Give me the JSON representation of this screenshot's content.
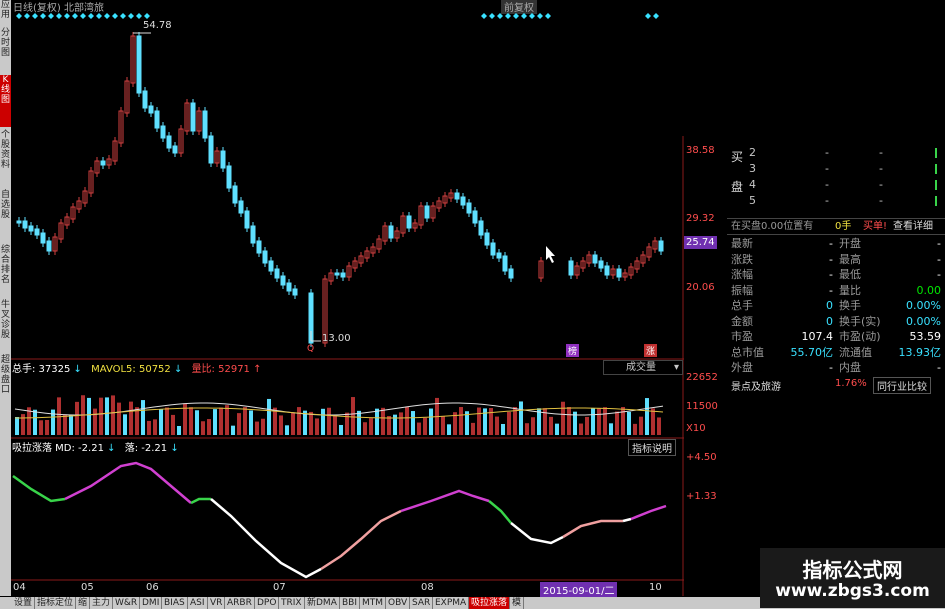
{
  "topbar": {
    "title": "日线(复权)  北部湾旅",
    "right_btn": "前复权"
  },
  "left_tabs": [
    {
      "label": "应用",
      "active": false
    },
    {
      "label": "分时图",
      "active": false
    },
    {
      "label": "K线图",
      "active": true
    },
    {
      "label": "个股资料",
      "active": false
    },
    {
      "label": "自选股",
      "active": false
    },
    {
      "label": "综合排名",
      "active": false
    },
    {
      "label": "牛叉诊股",
      "active": false
    },
    {
      "label": "超级盘口",
      "active": false
    }
  ],
  "main": {
    "high_label": "54.78",
    "low_label": "13.00",
    "q_label": "Q",
    "price_ticks": [
      "38.58",
      "29.32",
      "25.74",
      "20.06"
    ],
    "event_labels": [
      "榜",
      "涨"
    ]
  },
  "volume": {
    "total_label": "总手: 37325",
    "mavol_label": "MAVOL5: 50752",
    "ratio_label": "量比: 52971",
    "dropdown": "成交量",
    "ticks": [
      "22652",
      "11500",
      "X10"
    ]
  },
  "indicator": {
    "title": "吸拉涨落 MD: -2.21",
    "sub": "落: -2.21",
    "help_btn": "指标说明",
    "ticks": [
      "+4.50",
      "+1.33"
    ]
  },
  "xaxis": {
    "labels": [
      "04",
      "05",
      "06",
      "07",
      "08",
      "09",
      "10"
    ],
    "cursor_date": "2015-09-01/二"
  },
  "right_panel": {
    "buy_label": "买",
    "sell_label": "盘",
    "order_levels": [
      "2",
      "3",
      "4",
      "5"
    ],
    "order_dash": "-",
    "orderbar_label": "在买盘0.00位置有",
    "orderbar_hand": "0手",
    "orderbar_buy": "买单!",
    "orderbar_detail": "查看详细",
    "rows": [
      {
        "l": "最新",
        "lv": "-",
        "r": "开盘",
        "rv": "-"
      },
      {
        "l": "涨跌",
        "lv": "-",
        "r": "最高",
        "rv": "-"
      },
      {
        "l": "涨幅",
        "lv": "-",
        "r": "最低",
        "rv": "-"
      },
      {
        "l": "振幅",
        "lv": "-",
        "r": "量比",
        "rv": "0.00"
      },
      {
        "l": "总手",
        "lv": "0",
        "r": "换手",
        "rv": "0.00%"
      },
      {
        "l": "金额",
        "lv": "0",
        "r": "换手(实)",
        "rv": "0.00%"
      },
      {
        "l": "市盈",
        "lv": "107.4",
        "r": "市盈(动)",
        "rv": "53.59"
      },
      {
        "l": "总市值",
        "lv": "55.70亿",
        "r": "流通值",
        "rv": "13.93亿"
      },
      {
        "l": "外盘",
        "lv": "-",
        "r": "内盘",
        "rv": "-"
      }
    ],
    "sector": "景点及旅游",
    "sector_pct": "1.76%",
    "compare_btn": "同行业比较"
  },
  "bottom_tabs": [
    "设置",
    "指标定位",
    "缩",
    "主力",
    "W&R",
    "DMI",
    "BIAS",
    "ASI",
    "VR",
    "ARBR",
    "DPO",
    "TRIX",
    "新DMA",
    "BBI",
    "MTM",
    "OBV",
    "SAR",
    "EXPMA",
    "吸拉涨落",
    "模"
  ],
  "watermark": {
    "title": "指标公式网",
    "url": "www.zbgs3.com"
  },
  "colors": {
    "up": "#d04040",
    "down": "#5fe0ff",
    "bg": "#000000"
  },
  "chart_data": {
    "type": "candlestick",
    "price_range": [
      13.0,
      54.78
    ],
    "volume_max": 22652,
    "indicator_range": [
      -12,
      4.5
    ]
  }
}
